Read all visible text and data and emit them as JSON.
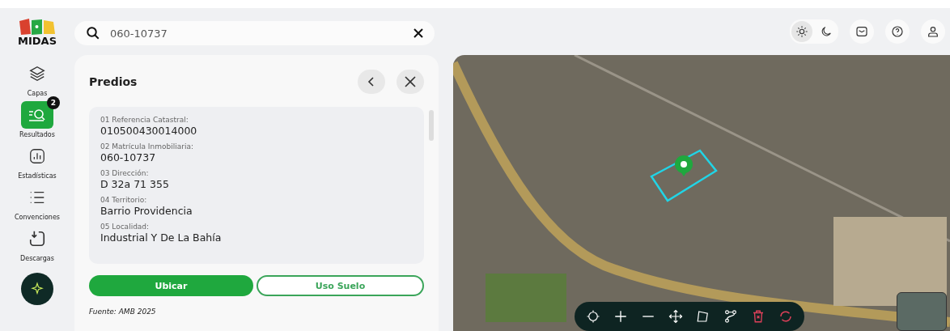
{
  "logo": {
    "text": "MIDAS"
  },
  "search": {
    "value": "060-10737"
  },
  "theme": [
    {
      "kind": "light",
      "selected": true
    },
    {
      "kind": "dark",
      "selected": false
    }
  ],
  "sidebar": {
    "items": [
      {
        "kind": "layers",
        "label": "Capas",
        "selected": false
      },
      {
        "kind": "results",
        "label": "Resultados",
        "selected": true,
        "badge": "2"
      },
      {
        "kind": "stats",
        "label": "Estadísticas",
        "selected": false
      },
      {
        "kind": "legend",
        "label": "Convenciones",
        "selected": false
      },
      {
        "kind": "download",
        "label": "Descargas",
        "selected": false
      }
    ]
  },
  "panel": {
    "title": "Predios",
    "fields": [
      {
        "label": "01 Referencia Catastral:",
        "value": "010500430014000"
      },
      {
        "label": "02 Matrícula Inmobiliaria:",
        "value": "060-10737"
      },
      {
        "label": "03 Dirección:",
        "value": "D 32a 71 355"
      },
      {
        "label": "04 Territorio:",
        "value": "Barrio Providencia"
      },
      {
        "label": "05 Localidad:",
        "value": "Industrial Y De La Bahía"
      }
    ],
    "buttons": [
      {
        "label": "Ubicar",
        "kind": "primary"
      },
      {
        "label": "Uso Suelo",
        "kind": "outline"
      }
    ],
    "source": "Fuente: AMB 2025"
  },
  "map_tools": [
    {
      "kind": "locate"
    },
    {
      "kind": "zoom-in"
    },
    {
      "kind": "zoom-out"
    },
    {
      "kind": "pan"
    },
    {
      "kind": "polygon"
    },
    {
      "kind": "route"
    },
    {
      "kind": "delete"
    },
    {
      "kind": "refresh"
    }
  ]
}
